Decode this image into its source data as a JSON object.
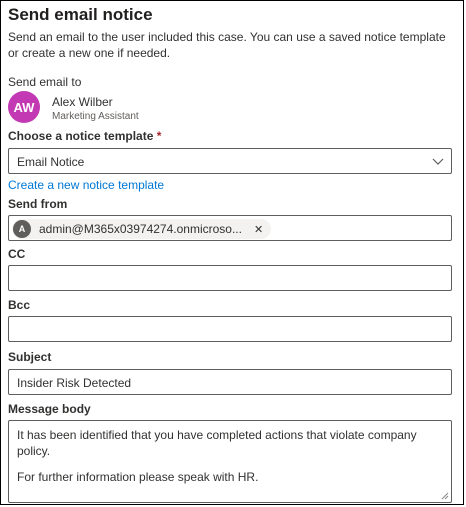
{
  "panel": {
    "title": "Send email notice",
    "description": "Send an email to the user included this case. You can use a saved notice template or create a new one if needed."
  },
  "recipient": {
    "label": "Send email to",
    "initials": "AW",
    "name": "Alex Wilber",
    "job_title": "Marketing Assistant",
    "avatar_color": "#c239b3"
  },
  "template": {
    "label": "Choose a notice template",
    "required_mark": "*",
    "selected": "Email Notice",
    "create_link": "Create a new notice template"
  },
  "send_from": {
    "label": "Send from",
    "initial": "A",
    "value": "admin@M365x03974274.onmicroso...",
    "remove_glyph": "✕"
  },
  "cc": {
    "label": "CC",
    "value": ""
  },
  "bcc": {
    "label": "Bcc",
    "value": ""
  },
  "subject": {
    "label": "Subject",
    "value": "Insider Risk Detected"
  },
  "message_body": {
    "label": "Message body",
    "paragraph1": "It has been identified that you have completed actions that violate company policy.",
    "paragraph2": "For further information please speak with HR."
  },
  "colors": {
    "link": "#0078d4",
    "required": "#a4262c",
    "border": "#605e5c"
  }
}
